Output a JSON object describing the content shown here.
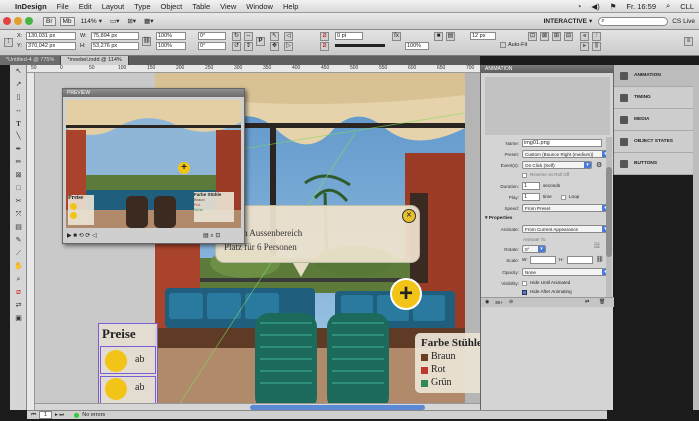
{
  "menubar": {
    "app_name": "InDesign",
    "items": [
      "File",
      "Edit",
      "Layout",
      "Type",
      "Object",
      "Table",
      "View",
      "Window",
      "Help"
    ],
    "clock": "Fr. 16:59",
    "user": "CLL"
  },
  "appbar": {
    "zoom": "114%",
    "workspace": "INTERACTIVE",
    "search_placeholder": ""
  },
  "control": {
    "x": "130,031 px",
    "y": "370,042 px",
    "w": "75,894 px",
    "h": "53,276 px",
    "scale_x": "100%",
    "scale_y": "100%",
    "angle": "0°",
    "shear": "0°",
    "stroke": "0 pt",
    "opacity": "100%",
    "effect_w": "12 px",
    "autofit": "Auto-Fit"
  },
  "doctabs": [
    {
      "label": "*Untitled-4 @ 775%",
      "active": false
    },
    {
      "label": "*moebel.indd @ 114%",
      "active": true
    }
  ],
  "ruler_ticks": [
    "50",
    "0",
    "50",
    "100",
    "150",
    "200",
    "250",
    "300",
    "350",
    "400",
    "450",
    "500",
    "550",
    "600",
    "650",
    "700"
  ],
  "preview": {
    "title": "PREVIEW",
    "preise": "Preise",
    "farbe": "Farbe Stühle",
    "colors": [
      "Braun",
      "Rot",
      "Grün"
    ]
  },
  "scene": {
    "callout_line1": "im Aussenbereich",
    "callout_line2": "Platz für 6 Personen",
    "preise_title": "Preise",
    "preise_items": [
      "ab",
      "ab"
    ],
    "farbe_title": "Farbe Stühle",
    "farbe_items": [
      {
        "label": "Braun",
        "color": "#6b3f22"
      },
      {
        "label": "Rot",
        "color": "#c0392b"
      },
      {
        "label": "Grün",
        "color": "#2e8b57"
      }
    ]
  },
  "animation": {
    "title": "ANIMATION",
    "name": "img01.png",
    "preset": "Custom (Bounce Right (medium))",
    "event": "On Click (Self)",
    "reverse_label": "Reverse on Roll Off",
    "duration": "1",
    "duration_unit": "seconds",
    "play": "1",
    "play_unit": "time",
    "loop_label": "Loop",
    "speed": "From Preset",
    "properties_label": "Properties",
    "animate": "From Current Appearance",
    "animate_to_label": "Animate To",
    "rotate": "0°",
    "scale_w": "",
    "scale_h": "",
    "opacity": "None",
    "hide_until": "Hide Until Animated",
    "hide_after": "Hide After Animating",
    "labels": {
      "name": "Name:",
      "preset": "Preset:",
      "event": "Event(s):",
      "duration": "Duration:",
      "play": "Play:",
      "speed": "Speed:",
      "animate": "Animate:",
      "rotate": "Rotate:",
      "scale": "Scale:",
      "opacity": "Opacity:",
      "visibility": "Visibility:"
    },
    "footer": "36+"
  },
  "dock": [
    "ANIMATION",
    "TIMING",
    "MEDIA",
    "OBJECT STATES",
    "BUTTONS"
  ],
  "status": {
    "page": "1",
    "errors": "No errors"
  }
}
